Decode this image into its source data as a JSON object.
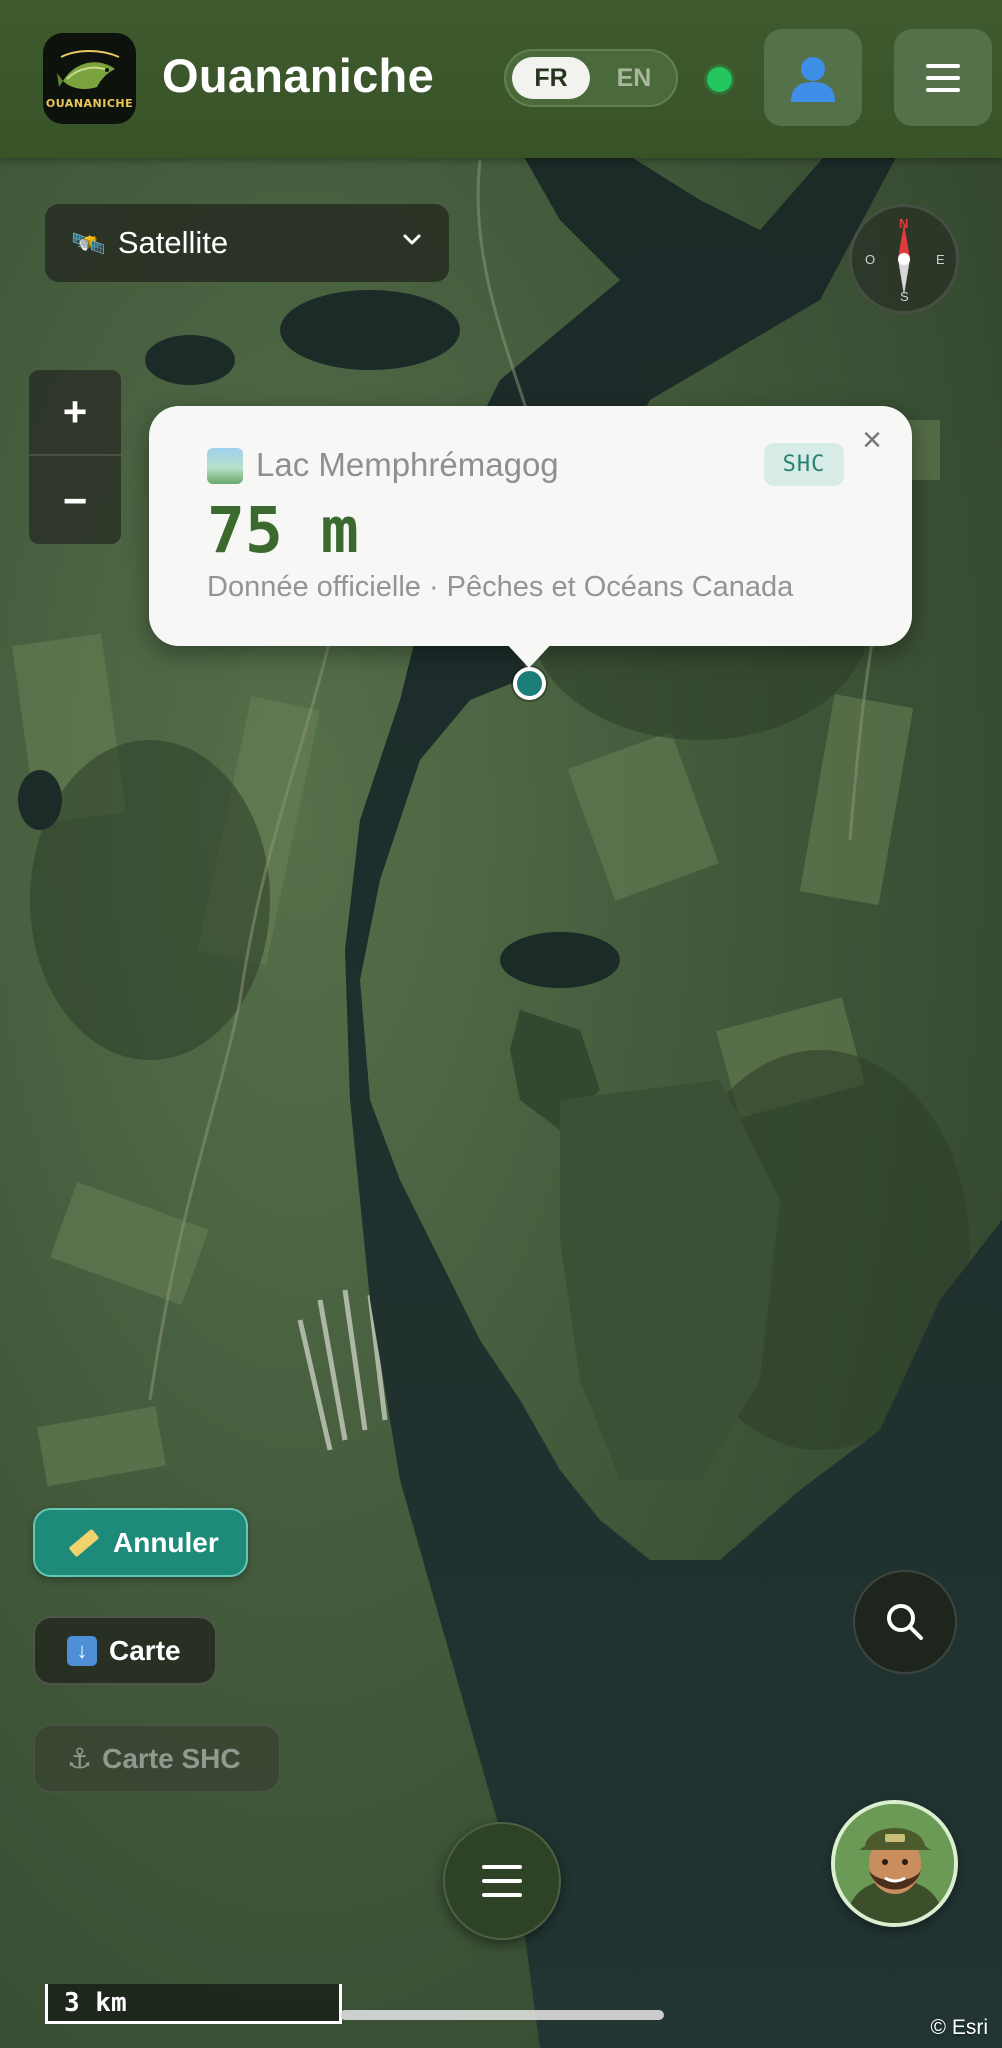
{
  "header": {
    "app_title": "Ouananiche",
    "logo_text": "OUANANICHE",
    "lang_fr": "FR",
    "lang_en": "EN",
    "active_lang": "FR",
    "status": "online",
    "user_icon": "user-icon",
    "menu_icon": "hamburger-icon"
  },
  "map": {
    "layer_select": {
      "icon": "satellite-icon",
      "selected": "Satellite"
    },
    "compass": {
      "n": "N",
      "s": "S",
      "e": "E",
      "o": "O"
    },
    "zoom_in": "+",
    "zoom_out": "−",
    "scale_label": "3 km",
    "attribution": "© Esri"
  },
  "popup": {
    "lake_name": "Lac Memphrémagog",
    "badge": "SHC",
    "depth": "75 m",
    "source": "Donnée officielle · Pêches et Océans Canada",
    "close": "×"
  },
  "actions": {
    "annuler": "Annuler",
    "carte": "Carte",
    "carte_shc": "Carte SHC"
  },
  "colors": {
    "header_bg": "#3e5a2e",
    "accent_teal": "#1d8a7a",
    "depth_green": "#3c6a2e",
    "status_green": "#22c55e"
  }
}
